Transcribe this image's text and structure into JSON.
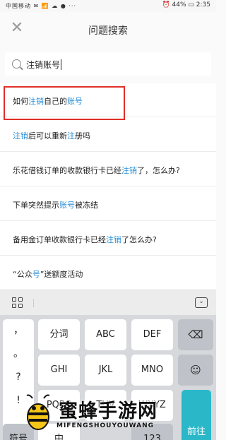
{
  "status_bar": {
    "left": "中国移动 ✉ 📶 ☁ ● ···",
    "right": "⏰ 44% ▭ 2:35"
  },
  "header": {
    "title": "问题搜索"
  },
  "search": {
    "value": "注销账号"
  },
  "results": [
    {
      "parts": [
        {
          "t": "如何",
          "hl": false
        },
        {
          "t": "注销",
          "hl": true
        },
        {
          "t": "自己的",
          "hl": false
        },
        {
          "t": "账号",
          "hl": true
        }
      ]
    },
    {
      "parts": [
        {
          "t": "注销",
          "hl": true
        },
        {
          "t": "后可以重新",
          "hl": false
        },
        {
          "t": "注",
          "hl": true
        },
        {
          "t": "册吗",
          "hl": false
        }
      ]
    },
    {
      "parts": [
        {
          "t": "乐花借钱订单的收款银行卡已经",
          "hl": false
        },
        {
          "t": "注销",
          "hl": true
        },
        {
          "t": "了，怎么办?",
          "hl": false
        }
      ]
    },
    {
      "parts": [
        {
          "t": "下单突然提示",
          "hl": false
        },
        {
          "t": "账号",
          "hl": true
        },
        {
          "t": "被冻结",
          "hl": false
        }
      ]
    },
    {
      "parts": [
        {
          "t": "备用金订单收款银行卡已经",
          "hl": false
        },
        {
          "t": "注销",
          "hl": true
        },
        {
          "t": "了怎么办?",
          "hl": false
        }
      ]
    },
    {
      "parts": [
        {
          "t": "“公众",
          "hl": false
        },
        {
          "t": "号",
          "hl": true
        },
        {
          "t": "”送额度活动",
          "hl": false
        }
      ]
    }
  ],
  "colors": {
    "highlight": "#2a8fd6",
    "annotation_box": "#e0302a",
    "go_key": "#2ab8c9"
  },
  "keyboard": {
    "punct": [
      "，",
      "。",
      "?",
      "!"
    ],
    "row1": [
      "分词",
      "ABC",
      "DEF"
    ],
    "row2": [
      "GHI",
      "JKL",
      "MNO"
    ],
    "row3": [
      "PQRS",
      "TUV",
      "WXYZ"
    ],
    "bottom": [
      "符号",
      "中",
      "123"
    ],
    "backspace": "⌫",
    "face": "☺",
    "go": "前往"
  },
  "watermark": {
    "text": "蜜蜂手游网",
    "sub": "MIFENGSHOUYOUWANG"
  }
}
